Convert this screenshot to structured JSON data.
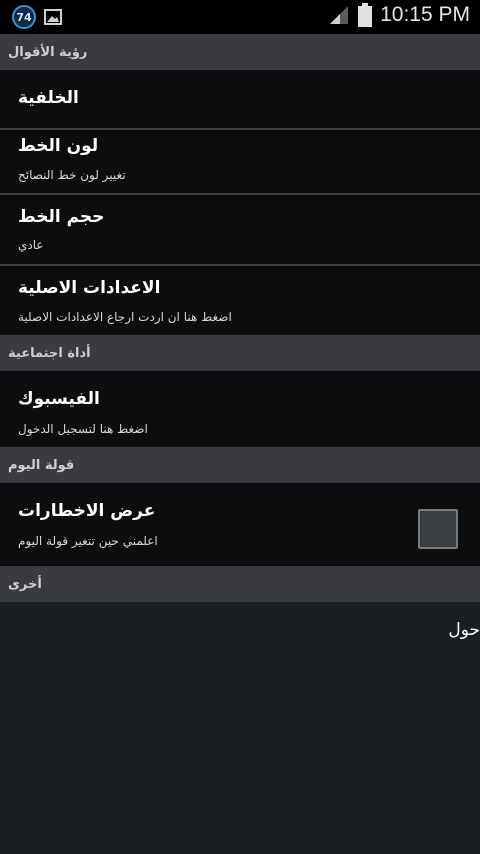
{
  "status_bar": {
    "badge": "74",
    "time": "10:15 PM",
    "icons": [
      "notification-badge-icon",
      "gallery-icon",
      "signal-icon",
      "battery-icon"
    ]
  },
  "sections": {
    "quotes_view": "رؤية الأقوال",
    "social_tool": "أداة اجتماعية",
    "quote_of_day": "قولة اليوم",
    "other": "أخرى"
  },
  "items": {
    "background": {
      "title": "الخلفية"
    },
    "font_color": {
      "title": "لون الخط",
      "subtitle": "تغيير لون خط النصائح"
    },
    "font_size": {
      "title": "حجم الخط",
      "subtitle": "عادي"
    },
    "reset": {
      "title": "الاعدادات الاصلية",
      "subtitle": "اضغط هنا ان اردت ارجاع الاعدادات الاصلية"
    },
    "facebook": {
      "title": "الفيسبوك",
      "subtitle": "اضغط هنا لتسجيل الدخول"
    },
    "notifications": {
      "title": "عرض الاخطارات",
      "subtitle": "اعلمني حين تتغير قولة اليوم",
      "checked": false
    },
    "about": {
      "title": "حول"
    }
  },
  "colors": {
    "status_bar": "#000000",
    "section_header": "#3a3b3e",
    "row_bg": "#0c0d0f",
    "page_bg": "#1b1e23"
  }
}
